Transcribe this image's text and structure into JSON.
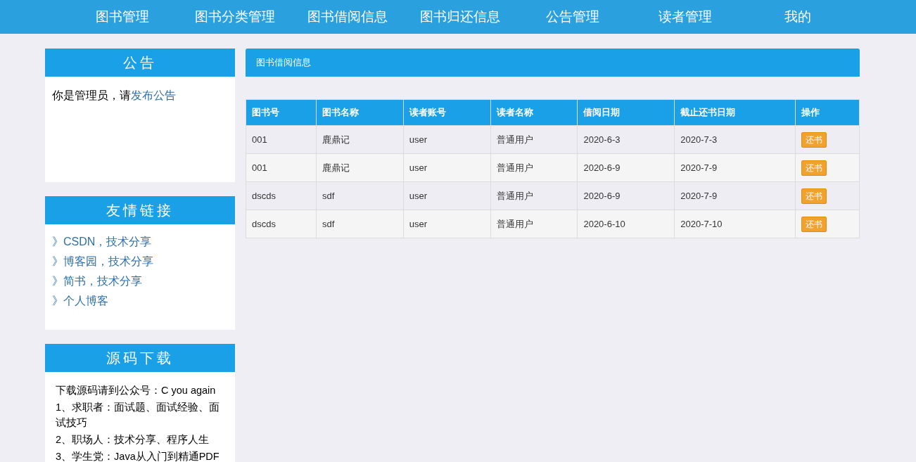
{
  "nav": [
    "图书管理",
    "图书分类管理",
    "图书借阅信息",
    "图书归还信息",
    "公告管理",
    "读者管理",
    "我的"
  ],
  "notice": {
    "title": "公告",
    "text": "你是管理员，请",
    "link": "发布公告"
  },
  "links": {
    "title": "友情链接",
    "items": [
      "》CSDN，技术分享",
      "》博客园，技术分享",
      "》简书，技术分享",
      "》个人博客"
    ]
  },
  "download": {
    "title": "源码下载",
    "lines": [
      "下载源码请到公众号：C you again",
      "1、求职者：面试题、面试经验、面试技巧",
      "2、职场人：技术分享、程序人生",
      "3、学生党：Java从入门到精通PDF"
    ]
  },
  "panel": {
    "title": "图书借阅信息"
  },
  "table": {
    "columns": [
      "图书号",
      "图书名称",
      "读者账号",
      "读者名称",
      "借阅日期",
      "截止还书日期",
      "操作"
    ],
    "rows": [
      {
        "cells": [
          "001",
          "鹿鼎记",
          "user",
          "普通用户",
          "2020-6-3",
          "2020-7-3"
        ],
        "action": "还书"
      },
      {
        "cells": [
          "001",
          "鹿鼎记",
          "user",
          "普通用户",
          "2020-6-9",
          "2020-7-9"
        ],
        "action": "还书"
      },
      {
        "cells": [
          "dscds",
          "sdf",
          "user",
          "普通用户",
          "2020-6-9",
          "2020-7-9"
        ],
        "action": "还书"
      },
      {
        "cells": [
          "dscds",
          "sdf",
          "user",
          "普通用户",
          "2020-6-10",
          "2020-7-10"
        ],
        "action": "还书"
      }
    ]
  }
}
